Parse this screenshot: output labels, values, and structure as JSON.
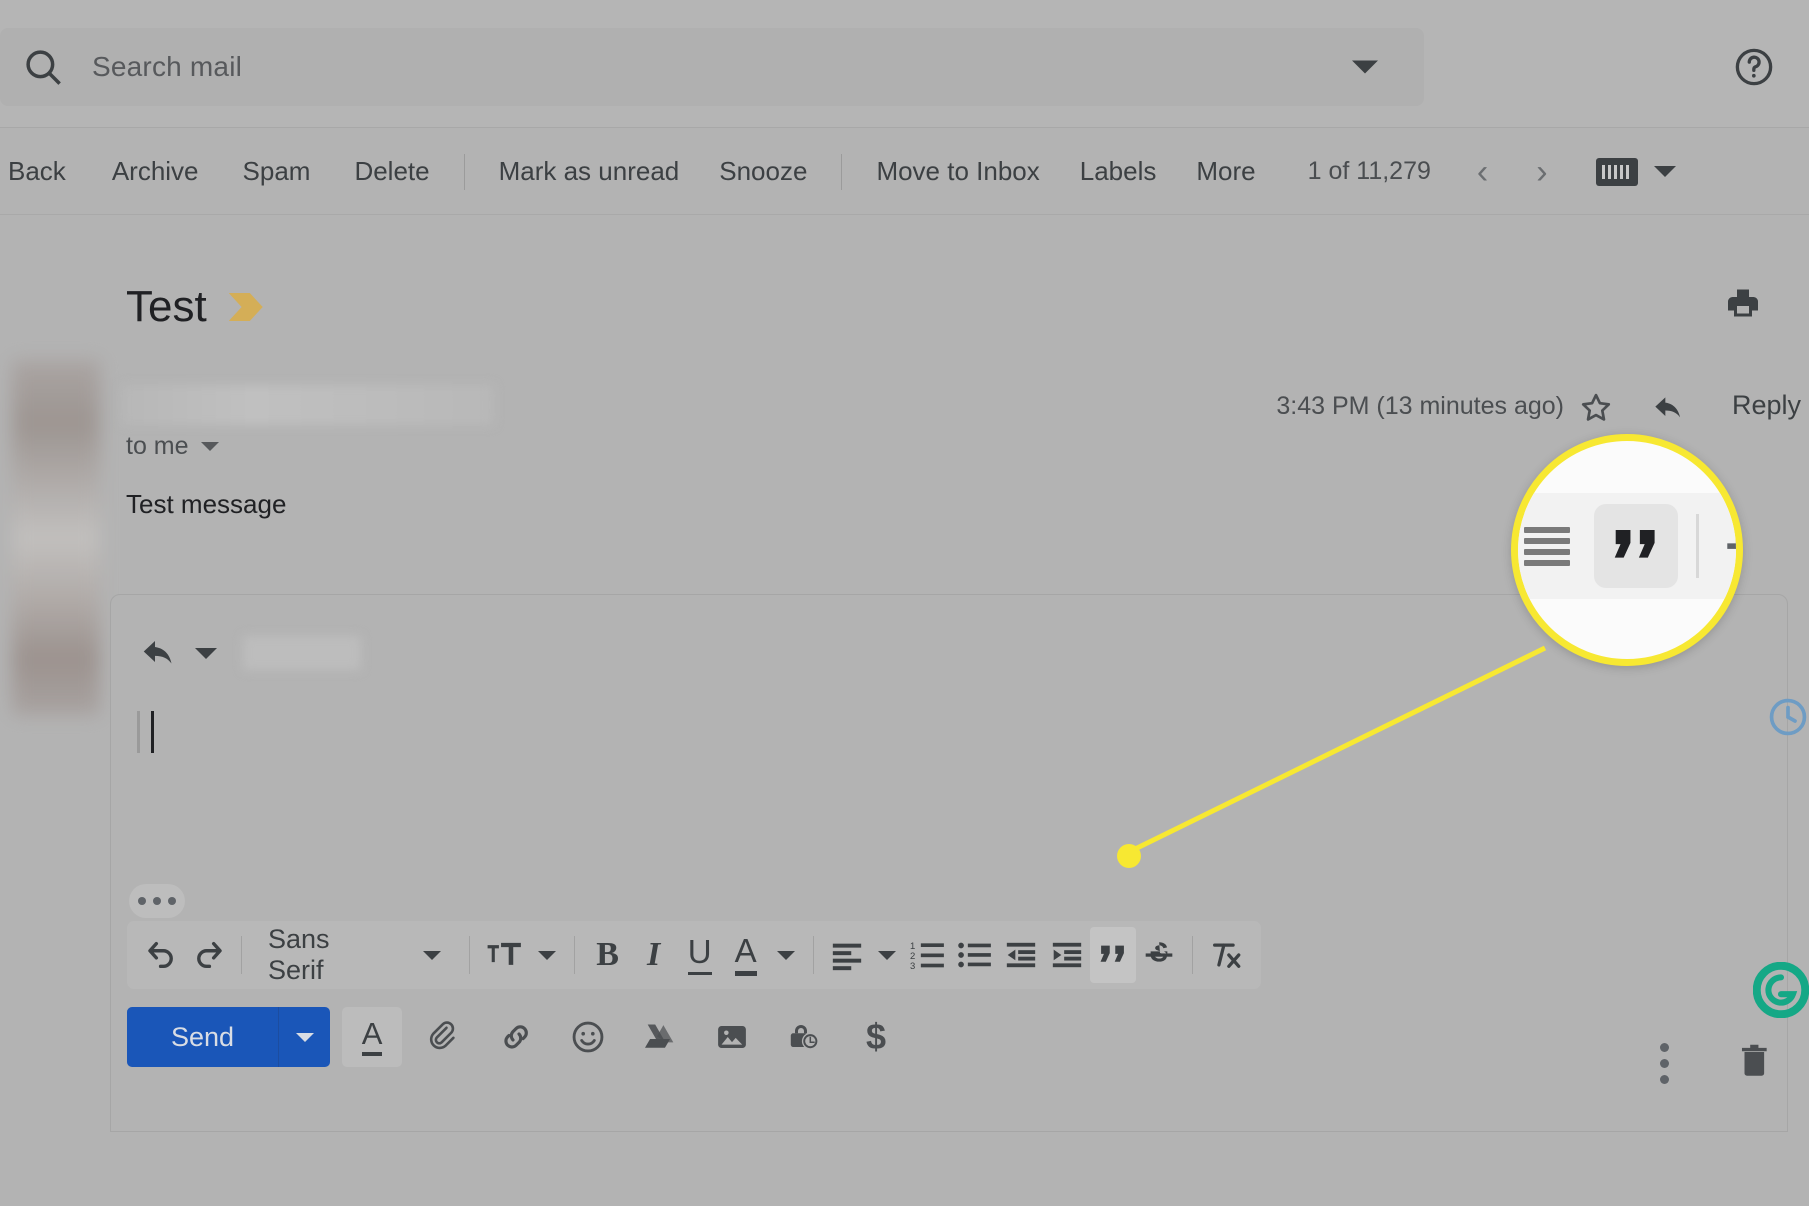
{
  "search": {
    "placeholder": "Search mail",
    "icon": "search-icon",
    "dropdown_icon": "chevron-down-icon",
    "help_icon": "help-circle-icon"
  },
  "actionbar": {
    "items": [
      {
        "label": "Back",
        "name": "back-button"
      },
      {
        "label": "Archive",
        "name": "archive-button"
      },
      {
        "label": "Spam",
        "name": "spam-button"
      },
      {
        "label": "Delete",
        "name": "delete-button"
      },
      {
        "label": "Mark as unread",
        "name": "mark-as-unread-button"
      },
      {
        "label": "Snooze",
        "name": "snooze-button"
      },
      {
        "label": "Move to Inbox",
        "name": "move-to-inbox-button"
      },
      {
        "label": "Labels",
        "name": "labels-button"
      },
      {
        "label": "More",
        "name": "more-button"
      }
    ],
    "page_count": "1 of 11,279",
    "prev_icon": "chevron-left-icon",
    "next_icon": "chevron-right-icon",
    "keyboard_icon": "keyboard-icon",
    "keyboard_caret_icon": "chevron-down-icon"
  },
  "message": {
    "subject": "Test",
    "important_marker_icon": "important-marker-icon",
    "print_icon": "printer-icon",
    "to_line": "to me",
    "to_caret_icon": "chevron-down-icon",
    "body": "Test message",
    "timestamp": "3:43 PM (13 minutes ago)",
    "star_icon": "star-outline-icon",
    "reply_arrow_icon": "reply-arrow-icon",
    "reply_label": "Reply"
  },
  "compose": {
    "mode_icon": "reply-arrow-icon",
    "mode_caret_icon": "chevron-down-icon",
    "more_options_icon": "ellipsis-icon",
    "format_toolbar": [
      {
        "name": "undo-button",
        "icon": "undo-icon",
        "active": false
      },
      {
        "name": "redo-button",
        "icon": "redo-icon",
        "active": false
      },
      {
        "name": "font-family-select",
        "label": "Sans Serif",
        "icon": "chevron-down-icon",
        "active": false
      },
      {
        "name": "font-size-button",
        "icon": "font-size-icon",
        "active": false
      },
      {
        "name": "bold-button",
        "label": "B",
        "icon": "bold-icon",
        "active": false
      },
      {
        "name": "italic-button",
        "label": "I",
        "icon": "italic-icon",
        "active": false
      },
      {
        "name": "underline-button",
        "label": "U",
        "icon": "underline-icon",
        "active": false
      },
      {
        "name": "text-color-button",
        "label": "A",
        "icon": "text-color-icon",
        "active": false
      },
      {
        "name": "align-button",
        "icon": "align-left-icon",
        "active": false
      },
      {
        "name": "numbered-list-button",
        "icon": "numbered-list-icon",
        "active": false
      },
      {
        "name": "bulleted-list-button",
        "icon": "bulleted-list-icon",
        "active": false
      },
      {
        "name": "indent-less-button",
        "icon": "indent-decrease-icon",
        "active": false
      },
      {
        "name": "indent-more-button",
        "icon": "indent-increase-icon",
        "active": false
      },
      {
        "name": "quote-button",
        "icon": "quote-icon",
        "active": true
      },
      {
        "name": "strikethrough-button",
        "icon": "strikethrough-icon",
        "active": false
      },
      {
        "name": "remove-formatting-button",
        "icon": "remove-formatting-icon",
        "active": false
      }
    ],
    "send_label": "Send",
    "send_caret_icon": "chevron-down-icon",
    "bottom_tools": [
      {
        "name": "formatting-options-button",
        "icon": "text-color-icon",
        "label": "A",
        "active": true
      },
      {
        "name": "attach-file-button",
        "icon": "paperclip-icon",
        "active": false
      },
      {
        "name": "insert-link-button",
        "icon": "link-icon",
        "active": false
      },
      {
        "name": "insert-emoji-button",
        "icon": "emoji-icon",
        "active": false
      },
      {
        "name": "insert-drive-button",
        "icon": "google-drive-icon",
        "active": false
      },
      {
        "name": "insert-photo-button",
        "icon": "image-icon",
        "active": false
      },
      {
        "name": "confidential-mode-button",
        "icon": "lock-clock-icon",
        "active": false
      },
      {
        "name": "insert-money-button",
        "icon": "dollar-icon",
        "label": "$",
        "active": false
      }
    ],
    "more_menu_icon": "vertical-dots-icon",
    "discard_icon": "trash-icon"
  },
  "sidebar_right": {
    "clock_icon": "clock-icon",
    "grammarly_icon": "grammarly-icon"
  },
  "callout": {
    "highlight_color": "#f7e832",
    "magnified_icon": "quote-icon",
    "neighbor_left_icon": "align-justify-icon",
    "neighbor_right_icon": "strikethrough-icon"
  },
  "colors": {
    "send_blue": "#1a56b8",
    "highlight_yellow": "#f7e832",
    "important_gold": "#d4ae57",
    "grammarly_green": "#15a886",
    "clock_blue": "#6e9cc4"
  }
}
